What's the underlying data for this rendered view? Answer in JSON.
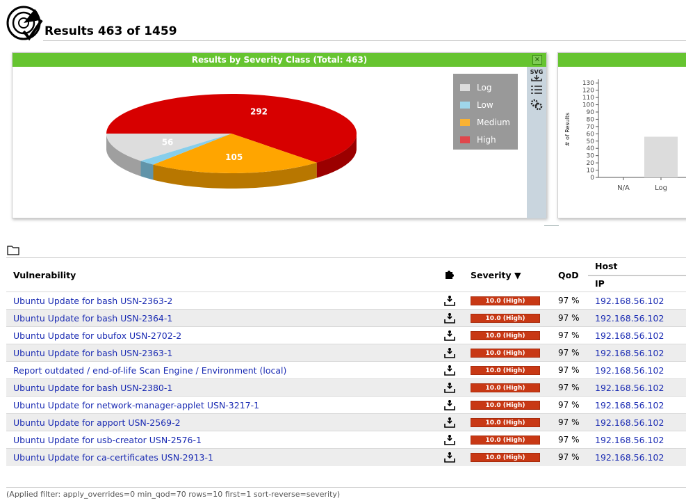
{
  "header": {
    "title": "Results 463 of 1459"
  },
  "severity_panel": {
    "title": "Results by Severity Class (Total: 463)",
    "close_symbol": "×",
    "tools": {
      "svg_label": "SVG"
    },
    "legend": [
      {
        "label": "Log",
        "color": "#dcdcdc"
      },
      {
        "label": "Low",
        "color": "#9fd6ea"
      },
      {
        "label": "Medium",
        "color": "#f9b233"
      },
      {
        "label": "High",
        "color": "#e0474c"
      }
    ]
  },
  "chart_data": [
    {
      "type": "pie",
      "title": "Results by Severity Class (Total: 463)",
      "slices": [
        {
          "label": "High",
          "value": 292,
          "color": "#d70000"
        },
        {
          "label": "Medium",
          "value": 105,
          "color": "#ffa500"
        },
        {
          "label": "Low",
          "value": 10,
          "color": "#87ceeb"
        },
        {
          "label": "Log",
          "value": 56,
          "color": "#dddddd"
        }
      ],
      "data_labels": [
        "292",
        "105",
        "56"
      ]
    },
    {
      "type": "bar",
      "ylabel": "# of Results",
      "categories": [
        "N/A",
        "Log"
      ],
      "values": [
        0,
        56
      ],
      "yticks": [
        "0",
        "10",
        "20",
        "30",
        "40",
        "50",
        "60",
        "70",
        "80",
        "90",
        "100",
        "110",
        "120",
        "130"
      ],
      "ylim": [
        0,
        135
      ]
    }
  ],
  "table": {
    "columns": {
      "vulnerability": "Vulnerability",
      "severity": "Severity ▼",
      "qod": "QoD",
      "host": "Host",
      "ip": "IP"
    },
    "rows": [
      {
        "name": "Ubuntu Update for bash USN-2363-2",
        "severity": "10.0 (High)",
        "qod": "97 %",
        "ip": "192.168.56.102"
      },
      {
        "name": "Ubuntu Update for bash USN-2364-1",
        "severity": "10.0 (High)",
        "qod": "97 %",
        "ip": "192.168.56.102"
      },
      {
        "name": "Ubuntu Update for ubufox USN-2702-2",
        "severity": "10.0 (High)",
        "qod": "97 %",
        "ip": "192.168.56.102"
      },
      {
        "name": "Ubuntu Update for bash USN-2363-1",
        "severity": "10.0 (High)",
        "qod": "97 %",
        "ip": "192.168.56.102"
      },
      {
        "name": "Report outdated / end-of-life Scan Engine / Environment (local)",
        "severity": "10.0 (High)",
        "qod": "97 %",
        "ip": "192.168.56.102"
      },
      {
        "name": "Ubuntu Update for bash USN-2380-1",
        "severity": "10.0 (High)",
        "qod": "97 %",
        "ip": "192.168.56.102"
      },
      {
        "name": "Ubuntu Update for network-manager-applet USN-3217-1",
        "severity": "10.0 (High)",
        "qod": "97 %",
        "ip": "192.168.56.102"
      },
      {
        "name": "Ubuntu Update for apport USN-2569-2",
        "severity": "10.0 (High)",
        "qod": "97 %",
        "ip": "192.168.56.102"
      },
      {
        "name": "Ubuntu Update for usb-creator USN-2576-1",
        "severity": "10.0 (High)",
        "qod": "97 %",
        "ip": "192.168.56.102"
      },
      {
        "name": "Ubuntu Update for ca-certificates USN-2913-1",
        "severity": "10.0 (High)",
        "qod": "97 %",
        "ip": "192.168.56.102"
      }
    ]
  },
  "footer": {
    "filter_text": "(Applied filter: apply_overrides=0 min_qod=70 rows=10 first=1 sort-reverse=severity)"
  }
}
